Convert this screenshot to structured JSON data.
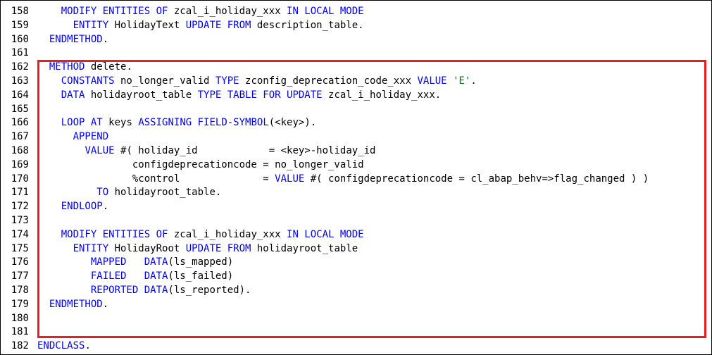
{
  "colors": {
    "keyword": "#0000ff",
    "string": "#008000",
    "text": "#000000",
    "highlight_border": "#e81e1e"
  },
  "code_lines": [
    {
      "n": "158",
      "tokens": [
        [
          "t",
          "    "
        ],
        [
          "k",
          "MODIFY ENTITIES OF"
        ],
        [
          "t",
          " zcal_i_holiday_xxx "
        ],
        [
          "k",
          "IN LOCAL MODE"
        ]
      ]
    },
    {
      "n": "159",
      "tokens": [
        [
          "t",
          "      "
        ],
        [
          "k",
          "ENTITY"
        ],
        [
          "t",
          " HolidayText "
        ],
        [
          "k",
          "UPDATE FROM"
        ],
        [
          "t",
          " description_table."
        ]
      ]
    },
    {
      "n": "160",
      "tokens": [
        [
          "t",
          "  "
        ],
        [
          "k",
          "ENDMETHOD"
        ],
        [
          "t",
          "."
        ]
      ]
    },
    {
      "n": "161",
      "tokens": []
    },
    {
      "n": "162",
      "tokens": [
        [
          "t",
          "  "
        ],
        [
          "k",
          "METHOD"
        ],
        [
          "t",
          " delete."
        ]
      ]
    },
    {
      "n": "163",
      "tokens": [
        [
          "t",
          "    "
        ],
        [
          "k",
          "CONSTANTS"
        ],
        [
          "t",
          " no_longer_valid "
        ],
        [
          "k",
          "TYPE"
        ],
        [
          "t",
          " zconfig_deprecation_code_xxx "
        ],
        [
          "k",
          "VALUE"
        ],
        [
          "t",
          " "
        ],
        [
          "s",
          "'E'"
        ],
        [
          "t",
          "."
        ]
      ]
    },
    {
      "n": "164",
      "tokens": [
        [
          "t",
          "    "
        ],
        [
          "k",
          "DATA"
        ],
        [
          "t",
          " holidayroot_table "
        ],
        [
          "k",
          "TYPE TABLE FOR UPDATE"
        ],
        [
          "t",
          " zcal_i_holiday_xxx."
        ]
      ]
    },
    {
      "n": "165",
      "tokens": []
    },
    {
      "n": "166",
      "tokens": [
        [
          "t",
          "    "
        ],
        [
          "k",
          "LOOP AT"
        ],
        [
          "t",
          " keys "
        ],
        [
          "k",
          "ASSIGNING FIELD-SYMBOL"
        ],
        [
          "t",
          "(<key>)."
        ]
      ]
    },
    {
      "n": "167",
      "tokens": [
        [
          "t",
          "      "
        ],
        [
          "k",
          "APPEND"
        ]
      ]
    },
    {
      "n": "168",
      "tokens": [
        [
          "t",
          "        "
        ],
        [
          "k",
          "VALUE"
        ],
        [
          "t",
          " #( holiday_id            = <key>-holiday_id"
        ]
      ]
    },
    {
      "n": "169",
      "tokens": [
        [
          "t",
          "                configdeprecationcode = no_longer_valid"
        ]
      ]
    },
    {
      "n": "170",
      "tokens": [
        [
          "t",
          "                %control              = "
        ],
        [
          "k",
          "VALUE"
        ],
        [
          "t",
          " #( configdeprecationcode = cl_abap_behv=>flag_changed ) )"
        ]
      ]
    },
    {
      "n": "171",
      "tokens": [
        [
          "t",
          "          "
        ],
        [
          "k",
          "TO"
        ],
        [
          "t",
          " holidayroot_table."
        ]
      ]
    },
    {
      "n": "172",
      "tokens": [
        [
          "t",
          "    "
        ],
        [
          "k",
          "ENDLOOP"
        ],
        [
          "t",
          "."
        ]
      ]
    },
    {
      "n": "173",
      "tokens": []
    },
    {
      "n": "174",
      "tokens": [
        [
          "t",
          "    "
        ],
        [
          "k",
          "MODIFY ENTITIES OF"
        ],
        [
          "t",
          " zcal_i_holiday_xxx "
        ],
        [
          "k",
          "IN LOCAL MODE"
        ]
      ]
    },
    {
      "n": "175",
      "tokens": [
        [
          "t",
          "      "
        ],
        [
          "k",
          "ENTITY"
        ],
        [
          "t",
          " HolidayRoot "
        ],
        [
          "k",
          "UPDATE FROM"
        ],
        [
          "t",
          " holidayroot_table"
        ]
      ]
    },
    {
      "n": "176",
      "tokens": [
        [
          "t",
          "         "
        ],
        [
          "k",
          "MAPPED"
        ],
        [
          "t",
          "   "
        ],
        [
          "k",
          "DATA"
        ],
        [
          "t",
          "(ls_mapped)"
        ]
      ]
    },
    {
      "n": "177",
      "tokens": [
        [
          "t",
          "         "
        ],
        [
          "k",
          "FAILED"
        ],
        [
          "t",
          "   "
        ],
        [
          "k",
          "DATA"
        ],
        [
          "t",
          "(ls_failed)"
        ]
      ]
    },
    {
      "n": "178",
      "tokens": [
        [
          "t",
          "         "
        ],
        [
          "k",
          "REPORTED"
        ],
        [
          "t",
          " "
        ],
        [
          "k",
          "DATA"
        ],
        [
          "t",
          "(ls_reported)."
        ]
      ]
    },
    {
      "n": "179",
      "tokens": [
        [
          "t",
          "  "
        ],
        [
          "k",
          "ENDMETHOD"
        ],
        [
          "t",
          "."
        ]
      ]
    },
    {
      "n": "180",
      "tokens": []
    },
    {
      "n": "181",
      "tokens": []
    },
    {
      "n": "182",
      "tokens": [
        [
          "k",
          "ENDCLASS"
        ],
        [
          "t",
          "."
        ]
      ]
    }
  ]
}
